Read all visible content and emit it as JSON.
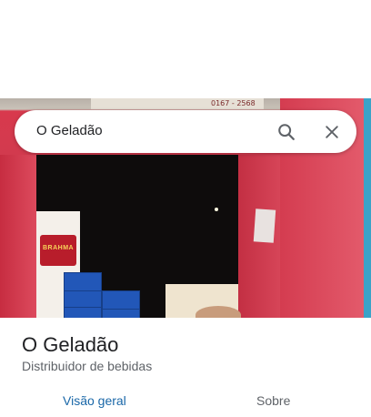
{
  "search": {
    "value": "O Geladão"
  },
  "photo": {
    "sign_text": "0167 - 2568",
    "fridge_brand": "BRAHMA"
  },
  "place": {
    "name": "O Geladão",
    "category": "Distribuidor de bebidas"
  },
  "tabs": [
    {
      "label": "Visão geral",
      "selected": true
    },
    {
      "label": "Sobre",
      "selected": false
    }
  ],
  "icons": {
    "search": "search-icon",
    "close": "close-icon"
  },
  "colors": {
    "accent": "#1967a8",
    "text_primary": "#202124",
    "text_secondary": "#5f6368"
  }
}
